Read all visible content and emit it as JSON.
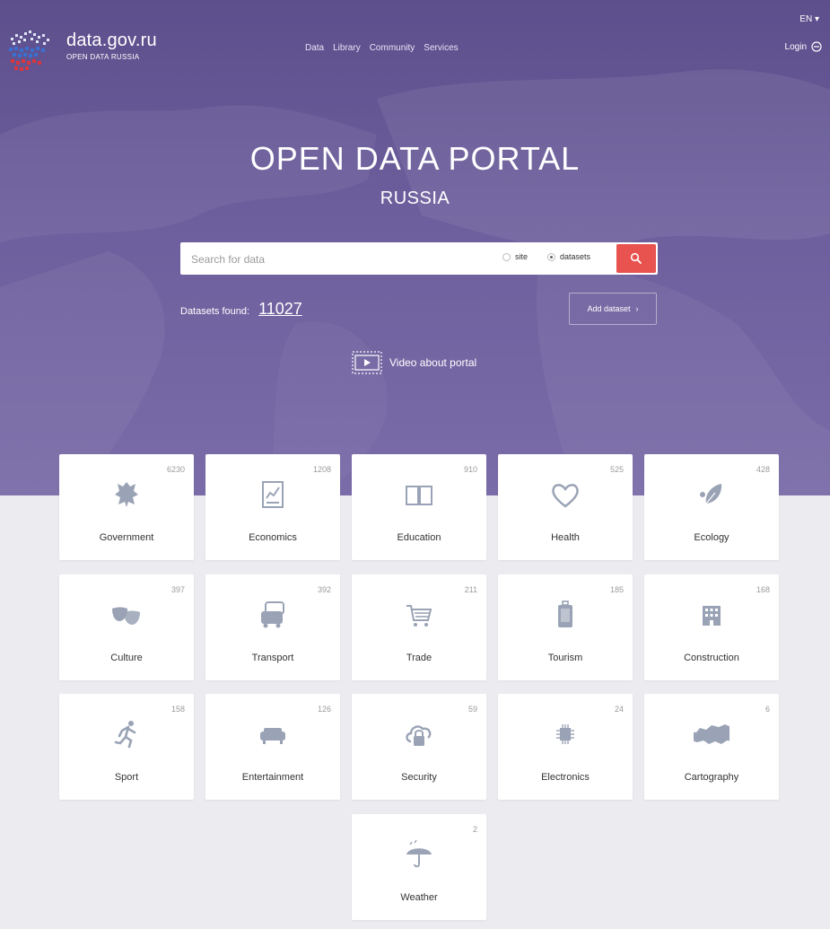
{
  "header": {
    "brand_name": "data.gov.ru",
    "brand_sub": "OPEN DATA RUSSIA",
    "nav": [
      "Data",
      "Library",
      "Community",
      "Services"
    ],
    "lang": "EN",
    "login": "Login"
  },
  "hero": {
    "title": "OPEN DATA PORTAL",
    "subtitle": "RUSSIA",
    "search_placeholder": "Search for data",
    "radio_site": "site",
    "radio_datasets": "datasets",
    "selected_scope": "datasets",
    "found_label": "Datasets found:",
    "found_count": "11027",
    "add_dataset": "Add dataset",
    "video": "Video about portal"
  },
  "colors": {
    "hero": "#6a5c9a",
    "accent": "#e8524f",
    "icon": "#9aa3b5"
  },
  "categories": [
    {
      "label": "Government",
      "count": "6230",
      "icon": "coat-of-arms-icon"
    },
    {
      "label": "Economics",
      "count": "1208",
      "icon": "chart-board-icon"
    },
    {
      "label": "Education",
      "count": "910",
      "icon": "book-icon"
    },
    {
      "label": "Health",
      "count": "525",
      "icon": "heart-icon"
    },
    {
      "label": "Ecology",
      "count": "428",
      "icon": "leaf-icon"
    },
    {
      "label": "Culture",
      "count": "397",
      "icon": "theater-masks-icon"
    },
    {
      "label": "Transport",
      "count": "392",
      "icon": "cars-icon"
    },
    {
      "label": "Trade",
      "count": "211",
      "icon": "shopping-cart-icon"
    },
    {
      "label": "Tourism",
      "count": "185",
      "icon": "suitcase-icon"
    },
    {
      "label": "Construction",
      "count": "168",
      "icon": "building-icon"
    },
    {
      "label": "Sport",
      "count": "158",
      "icon": "runner-icon"
    },
    {
      "label": "Entertainment",
      "count": "126",
      "icon": "sofa-icon"
    },
    {
      "label": "Security",
      "count": "59",
      "icon": "cloud-lock-icon"
    },
    {
      "label": "Electronics",
      "count": "24",
      "icon": "chip-icon"
    },
    {
      "label": "Cartography",
      "count": "6",
      "icon": "russia-map-icon"
    },
    {
      "label": "Weather",
      "count": "2",
      "icon": "umbrella-icon"
    }
  ]
}
